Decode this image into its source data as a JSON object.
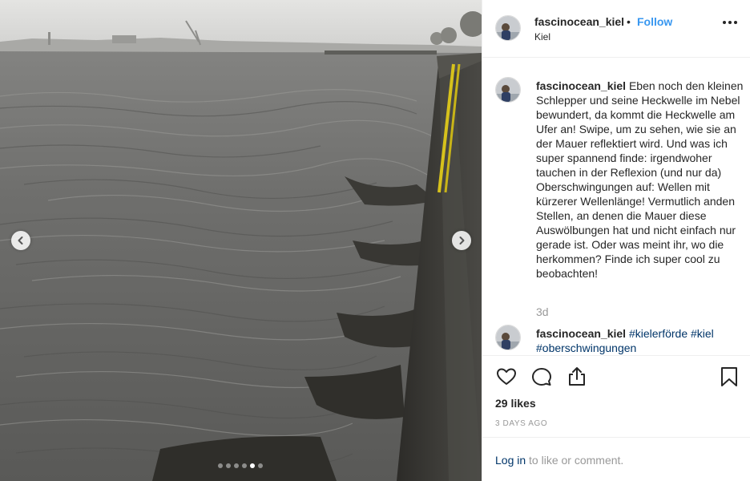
{
  "post": {
    "username": "fascinocean_kiel",
    "separator": "•",
    "follow_label": "Follow",
    "location": "Kiel",
    "carousel": {
      "total": 6,
      "active": 5
    }
  },
  "caption": {
    "username": "fascinocean_kiel",
    "text": "Eben noch den kleinen Schlepper und seine Heckwelle im Nebel bewundert, da kommt die Heckwelle am Ufer an! Swipe, um zu sehen, wie sie an der Mauer reflektiert wird. Und was ich super spannend finde: irgendwoher tauchen in der Reflexion (und nur da) Oberschwingungen auf: Wellen mit kürzerer Wellenlänge! Vermutlich anden Stellen, an denen die Mauer diese Auswölbungen hat und nicht einfach nur gerade ist. Oder was meint ihr, wo die herkommen? Finde ich super cool zu beobachten!",
    "time": "3d"
  },
  "comment2": {
    "username": "fascinocean_kiel",
    "tag1": "#kielerförde",
    "tag2": "#kiel",
    "tag3": "#oberschwingungen"
  },
  "engagement": {
    "likes": "29 likes",
    "date": "3 DAYS AGO"
  },
  "login": {
    "link": "Log in",
    "rest": " to like or comment."
  },
  "icons": [
    "heart-icon",
    "comment-icon",
    "share-icon",
    "bookmark-icon",
    "more-icon",
    "chevron-left-icon",
    "chevron-right-icon"
  ]
}
